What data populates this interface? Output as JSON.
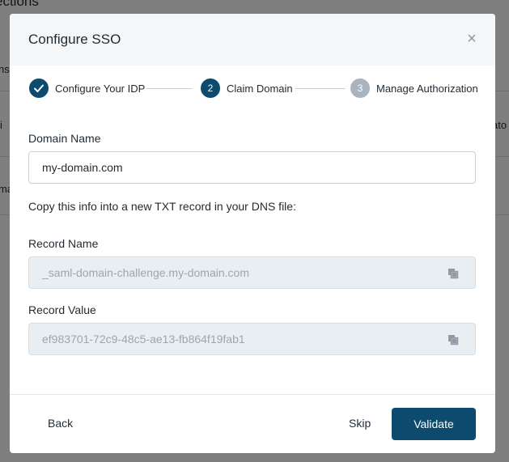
{
  "background": {
    "title_fragment": "ections",
    "fragments": [
      "ns",
      "i",
      "ato",
      "ma"
    ]
  },
  "modal": {
    "title": "Configure SSO",
    "close_glyph": "×"
  },
  "stepper": {
    "steps": [
      {
        "number": "",
        "label": "Configure Your IDP",
        "state": "complete"
      },
      {
        "number": "2",
        "label": "Claim Domain",
        "state": "active"
      },
      {
        "number": "3",
        "label": "Manage Authorization",
        "state": "pending"
      }
    ]
  },
  "form": {
    "domain_label": "Domain Name",
    "domain_value": "my-domain.com",
    "instruction": "Copy this info into a new TXT record in your DNS file:",
    "record_name_label": "Record Name",
    "record_name_value": "_saml-domain-challenge.my-domain.com",
    "record_value_label": "Record Value",
    "record_value_value": "ef983701-72c9-48c5-ae13-fb864f19fab1"
  },
  "footer": {
    "back_label": "Back",
    "skip_label": "Skip",
    "validate_label": "Validate"
  },
  "colors": {
    "primary": "#0c4a6e",
    "pending_step": "#a9b4bf"
  }
}
